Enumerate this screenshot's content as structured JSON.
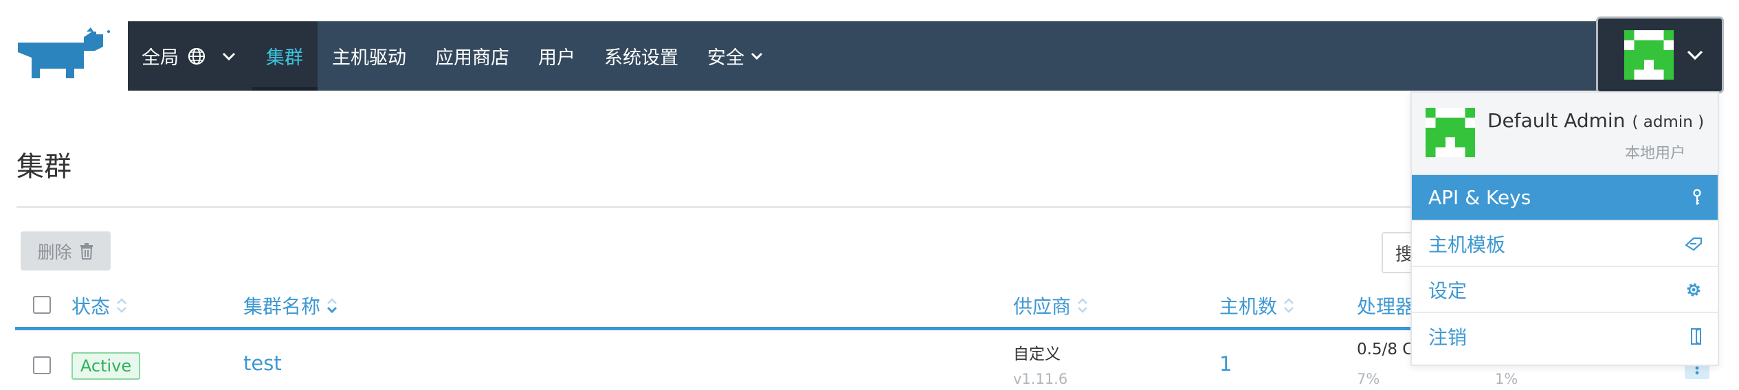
{
  "brand": {
    "logo_icon": "rancher-cow-logo"
  },
  "nav": {
    "scope_label": "全局",
    "items": [
      {
        "label": "集群",
        "active": true
      },
      {
        "label": "主机驱动"
      },
      {
        "label": "应用商店"
      },
      {
        "label": "用户"
      },
      {
        "label": "系统设置"
      },
      {
        "label": "安全"
      }
    ]
  },
  "page": {
    "title": "集群",
    "delete_label": "删除",
    "search_placeholder": "搜"
  },
  "table": {
    "columns": [
      "状态",
      "集群名称",
      "供应商",
      "主机数",
      "处理器"
    ],
    "rows": [
      {
        "state": "Active",
        "name": "test",
        "provider": "自定义",
        "version": "v1.11.6",
        "nodes": "1",
        "cpu": "0.5/8 C",
        "cpu_pct": "7%",
        "mem_pct": "1%"
      }
    ]
  },
  "user_menu": {
    "display_name": "Default Admin",
    "username": "( admin )",
    "user_type": "本地用户",
    "items": [
      {
        "label": "API & Keys",
        "icon": "key-icon",
        "active": true
      },
      {
        "label": "主机模板",
        "icon": "tag-icon"
      },
      {
        "label": "设定",
        "icon": "gear-icon"
      },
      {
        "label": "注销",
        "icon": "logout-icon"
      }
    ]
  },
  "colors": {
    "nav_bg": "#34495e",
    "nav_dark": "#27323e",
    "accent": "#3d98d3",
    "active_nav": "#3ec3df",
    "status_green": "#2fb15b",
    "avatar_green": "#34c33b"
  }
}
